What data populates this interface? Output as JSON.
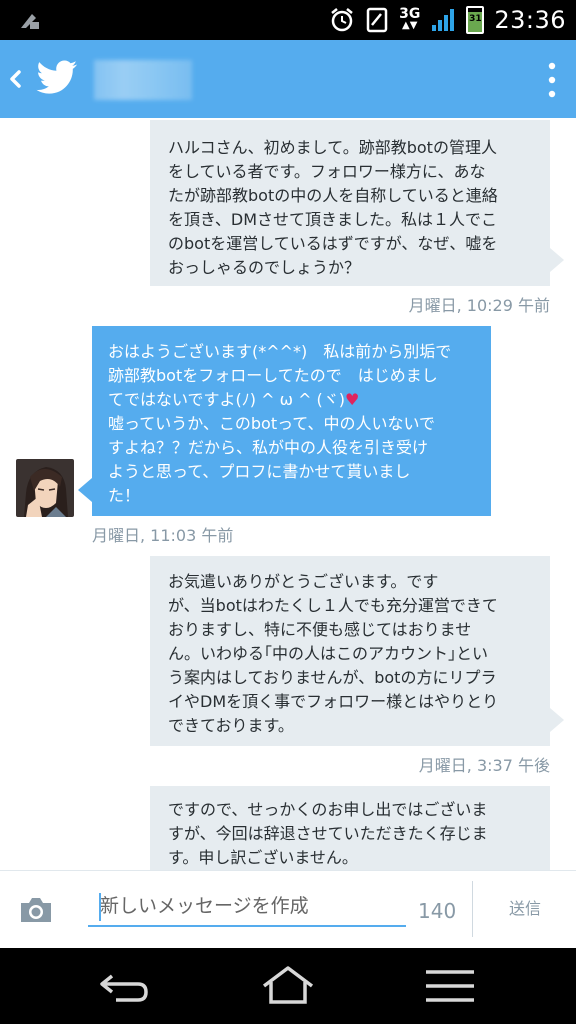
{
  "status_bar": {
    "network": "3G",
    "battery_date": "31",
    "time": "23:36"
  },
  "header": {
    "account_name": ""
  },
  "messages": [
    {
      "direction": "out",
      "text": "ハルコさん、初めまして。跡部教botの管理人\nをしている者です。フォロワー様方に、あな\nたが跡部教botの中の人を自称していると連絡\nを頂き、DMさせて頂きました。私は１人でこ\nのbotを運営しているはずですが、なぜ、嘘を\nおっしゃるのでしょうか？",
      "time": "月曜日, 10:29 午前"
    },
    {
      "direction": "in",
      "text_before_heart": "おはようございます(*^^*)　私は前から別垢で\n跡部教botをフォローしてたので　はじめまし\nてではないですよ(ﾉ) ^ ω ^ (ヾ)",
      "heart": "♥",
      "text_after_heart": "\n嘘っていうか、このbotって、中の人いないで\nすよね？？だから、私が中の人役を引き受け\nようと思って、プロフに書かせて貰いまし\nた！",
      "time": "月曜日, 11:03 午前"
    },
    {
      "direction": "out",
      "text": "お気遣いありがとうございます。です\nが、当botはわたくし１人でも充分運営できて\nおりますし、特に不便も感じてはおりませ\nん。いわゆる｢中の人はこのアカウント｣とい\nう案内はしておりませんが、botの方にリプラ\nイやDMを頂く事でフォロワー様とはやりとり\nできております。",
      "time": "月曜日, 3:37 午後"
    },
    {
      "direction": "out",
      "text": "ですので、せっかくのお申し出ではございま\nすが、今回は辞退させていただきたく存じま\nす。申し訳ございません。",
      "time": ""
    }
  ],
  "compose": {
    "placeholder": "新しいメッセージを作成",
    "char_count": "140",
    "send_label": "送信"
  },
  "colors": {
    "brand": "#55acee",
    "outgoing_bubble": "#e6ecf0",
    "incoming_bubble": "#55acee",
    "timestamp": "#8899a6",
    "heart": "#e0245e"
  },
  "icons": [
    "notification-icon",
    "alarm-icon",
    "screenshot-icon",
    "signal-icon",
    "battery-icon",
    "back-chevron-icon",
    "twitter-bird-icon",
    "overflow-menu-icon",
    "camera-icon",
    "nav-back-icon",
    "nav-home-icon",
    "nav-recents-icon"
  ]
}
